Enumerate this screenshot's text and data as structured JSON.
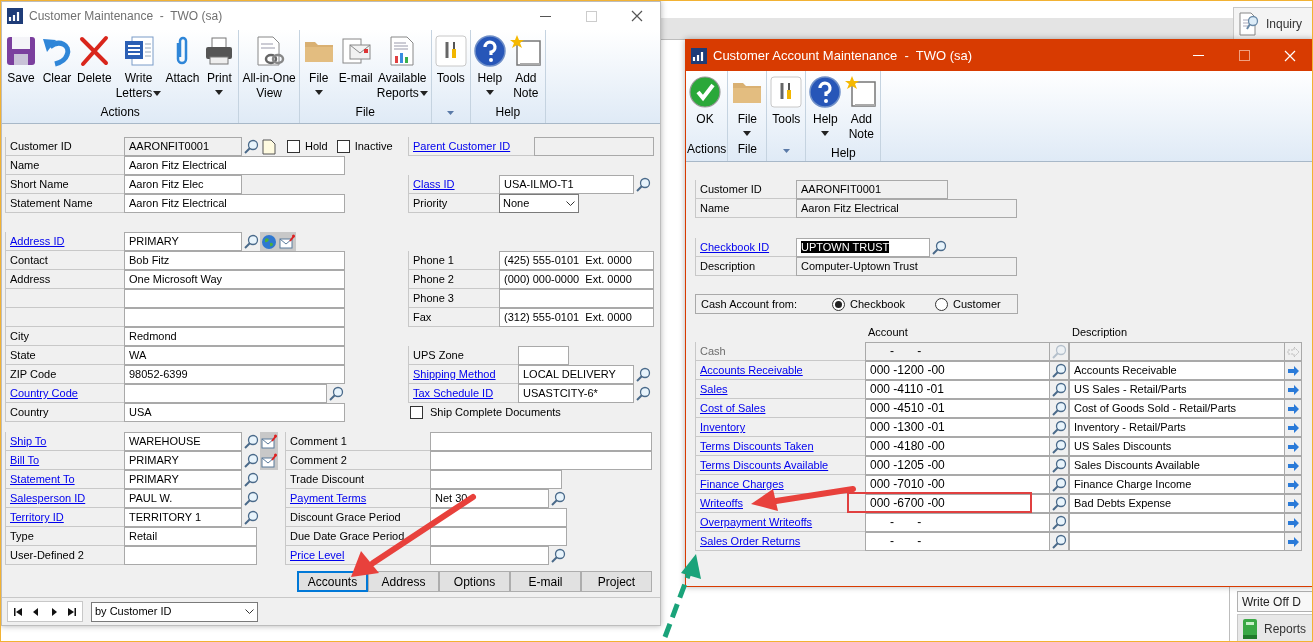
{
  "desktop": {
    "inquiry_button": "Inquiry",
    "write_off_button": "Write Off D",
    "reports_button": "Reports"
  },
  "customer_window": {
    "title": "Customer Maintenance  -  TWO (sa)",
    "ribbon": [
      {
        "label": "Actions",
        "buttons": [
          {
            "label": "Save",
            "dropdown": false
          },
          {
            "label": "Clear",
            "dropdown": false
          },
          {
            "label": "Delete",
            "dropdown": false
          },
          {
            "label": "Write Letters",
            "dropdown": true
          },
          {
            "label": "Attach",
            "dropdown": false
          },
          {
            "label": "Print",
            "dropdown": true
          }
        ]
      },
      {
        "buttons": [
          {
            "label": "All-in-One View",
            "dropdown": false
          }
        ]
      },
      {
        "label": "File",
        "buttons": [
          {
            "label": "File",
            "dropdown": true
          },
          {
            "label": "E-mail",
            "dropdown": false
          },
          {
            "label": "Available Reports",
            "dropdown": true
          }
        ]
      },
      {
        "menu_caret": true,
        "buttons": [
          {
            "label": "Tools",
            "dropdown": false
          }
        ]
      },
      {
        "label": "Help",
        "buttons": [
          {
            "label": "Help",
            "dropdown": true
          },
          {
            "label": "Add Note",
            "dropdown": false
          }
        ]
      }
    ],
    "form": {
      "left_top": [
        [
          {
            "label": "Customer ID",
            "link": false,
            "kind": "readonly",
            "value": "AARONFIT0001",
            "lookup": true,
            "note": true,
            "checks": [
              {
                "label": "Hold",
                "checked": false
              },
              {
                "label": "Inactive",
                "checked": false
              }
            ]
          },
          {
            "label": "Name",
            "link": false,
            "kind": "text",
            "value": "Aaron Fitz Electrical"
          },
          {
            "label": "Short Name",
            "link": false,
            "kind": "text",
            "value": "Aaron Fitz Elec"
          },
          {
            "label": "Statement Name",
            "link": false,
            "kind": "text",
            "value": "Aaron Fitz Electrical"
          }
        ],
        [
          {
            "label": "Address ID",
            "link": true,
            "kind": "text",
            "value": "PRIMARY",
            "lookup": true,
            "globe": true,
            "mail": true
          },
          {
            "label": "Contact",
            "link": false,
            "kind": "text",
            "value": "Bob Fitz"
          },
          {
            "label": "Address",
            "link": false,
            "kind": "text",
            "value": "One Microsoft Way"
          },
          {
            "kind": "text"
          },
          {
            "kind": "text"
          },
          {
            "label": "City",
            "link": false,
            "kind": "text",
            "value": "Redmond"
          },
          {
            "label": "State",
            "link": false,
            "kind": "text",
            "value": "WA"
          },
          {
            "label": "ZIP Code",
            "link": false,
            "kind": "text",
            "value": "98052-6399"
          },
          {
            "label": "Country Code",
            "link": true,
            "kind": "text",
            "lookup": true
          },
          {
            "label": "Country",
            "link": false,
            "kind": "text",
            "value": "USA"
          }
        ]
      ],
      "right_top": [
        [
          {
            "label": "Parent Customer ID",
            "link": true,
            "kind": "readonly"
          }
        ],
        [
          {
            "label": "Class ID",
            "link": true,
            "kind": "text",
            "value": "USA-ILMO-T1",
            "lookup": true
          },
          {
            "label": "Priority",
            "link": false,
            "kind": "select",
            "value": "None"
          }
        ],
        [
          {
            "label": "Phone 1",
            "link": false,
            "kind": "text",
            "value": "(425) 555-0101  Ext. 0000"
          },
          {
            "label": "Phone 2",
            "link": false,
            "kind": "text",
            "value": "(000) 000-0000  Ext. 0000"
          },
          {
            "label": "Phone 3",
            "link": false,
            "kind": "text"
          },
          {
            "label": "Fax",
            "link": false,
            "kind": "text",
            "value": "(312) 555-0101  Ext. 0000"
          }
        ],
        [
          {
            "label": "UPS Zone",
            "link": false,
            "kind": "text"
          },
          {
            "label": "Shipping Method",
            "link": true,
            "kind": "text",
            "value": "LOCAL DELIVERY",
            "lookup": true
          },
          {
            "label": "Tax Schedule ID",
            "link": true,
            "kind": "text",
            "value": "USASTCITY-6*",
            "lookup": true
          },
          {
            "kind": "checkbox",
            "label": "Ship Complete Documents",
            "checked": false
          }
        ]
      ],
      "left_bottom": [
        [
          {
            "label": "Ship To",
            "link": true,
            "kind": "text",
            "value": "WAREHOUSE",
            "lookup": true,
            "mail": true
          },
          {
            "label": "Bill To",
            "link": true,
            "kind": "text",
            "value": "PRIMARY",
            "lookup": true,
            "mail": true
          },
          {
            "label": "Statement To",
            "link": true,
            "kind": "text",
            "value": "PRIMARY",
            "lookup": true
          },
          {
            "label": "Salesperson ID",
            "link": true,
            "kind": "text",
            "value": "PAUL W.",
            "lookup": true
          },
          {
            "label": "Territory ID",
            "link": true,
            "kind": "text",
            "value": "TERRITORY 1",
            "lookup": true
          },
          {
            "label": "Type",
            "link": false,
            "kind": "text",
            "value": "Retail"
          },
          {
            "label": "User-Defined 2",
            "link": false,
            "kind": "text"
          }
        ]
      ],
      "right_bottom": [
        [
          {
            "label": "Comment 1",
            "link": false,
            "kind": "text"
          },
          {
            "label": "Comment 2",
            "link": false,
            "kind": "text"
          }
        ],
        [
          {
            "label": "Trade Discount",
            "link": false,
            "kind": "text"
          },
          {
            "label": "Payment Terms",
            "link": true,
            "kind": "text",
            "value": "Net 30",
            "lookup": true
          },
          {
            "label": "Discount Grace Period",
            "link": false,
            "kind": "text"
          },
          {
            "label": "Due Date Grace Period",
            "link": false,
            "kind": "text"
          },
          {
            "label": "Price Level",
            "link": true,
            "kind": "text",
            "lookup": true
          }
        ]
      ],
      "buttons": [
        {
          "label": "Accounts",
          "focused": true
        },
        {
          "label": "Address",
          "focused": false
        },
        {
          "label": "Options",
          "focused": false
        },
        {
          "label": "E-mail",
          "focused": false
        },
        {
          "label": "Project",
          "focused": false
        }
      ],
      "browse": {
        "sort": "by Customer ID"
      }
    }
  },
  "account_window": {
    "title": "Customer Account Maintenance  -  TWO (sa)",
    "ribbon": [
      {
        "label": "Actions",
        "buttons": [
          {
            "label": "OK",
            "dropdown": false
          }
        ]
      },
      {
        "label": "File",
        "buttons": [
          {
            "label": "File",
            "dropdown": true
          }
        ]
      },
      {
        "menu_caret": true,
        "buttons": [
          {
            "label": "Tools",
            "dropdown": false
          }
        ]
      },
      {
        "label": "Help",
        "buttons": [
          {
            "label": "Help",
            "dropdown": true
          },
          {
            "label": "Add Note",
            "dropdown": false
          }
        ]
      }
    ],
    "customer": [
      {
        "label": "Customer ID",
        "link": false,
        "kind": "readonly",
        "value": "AARONFIT0001"
      },
      {
        "label": "Name",
        "link": false,
        "kind": "readonly",
        "value": "Aaron Fitz Electrical"
      }
    ],
    "checkbook": [
      {
        "label": "Checkbook ID",
        "link": true,
        "kind": "text",
        "value": "UPTOWN TRUST",
        "selected_text": true,
        "lookup": true
      },
      {
        "label": "Description",
        "link": false,
        "kind": "readonly",
        "value": "Computer-Uptown Trust"
      }
    ],
    "cash_from": {
      "label": "Cash Account from:",
      "options": [
        {
          "label": "Checkbook",
          "selected": true
        },
        {
          "label": "Customer",
          "selected": false
        }
      ]
    },
    "table": {
      "columns": [
        "Account",
        "Description"
      ],
      "rows": [
        {
          "label": "Cash",
          "disabled": true,
          "account": "      -       -"
        },
        {
          "label": "Accounts Receivable",
          "disabled": false,
          "account": "000 -1200 -00",
          "description": "Accounts Receivable"
        },
        {
          "label": "Sales",
          "disabled": false,
          "account": "000 -4110 -01",
          "description": "US Sales - Retail/Parts"
        },
        {
          "label": "Cost of Sales",
          "disabled": false,
          "account": "000 -4510 -01",
          "description": "Cost of Goods Sold - Retail/Parts"
        },
        {
          "label": "Inventory",
          "disabled": false,
          "account": "000 -1300 -01",
          "description": "Inventory - Retail/Parts"
        },
        {
          "label": "Terms Discounts Taken",
          "disabled": false,
          "account": "000 -4180 -00",
          "description": "US Sales Discounts"
        },
        {
          "label": "Terms Discounts Available",
          "disabled": false,
          "account": "000 -1205 -00",
          "description": "Sales Discounts Available"
        },
        {
          "label": "Finance Charges",
          "disabled": false,
          "account": "000 -7010 -00",
          "description": "Finance Charge Income"
        },
        {
          "label": "Writeoffs",
          "disabled": false,
          "account": "000 -6700 -00",
          "description": "Bad Debts Expense"
        },
        {
          "label": "Overpayment Writeoffs",
          "disabled": false,
          "account": "      -       -"
        },
        {
          "label": "Sales Order Returns",
          "disabled": false,
          "account": "      -       -"
        }
      ]
    }
  }
}
